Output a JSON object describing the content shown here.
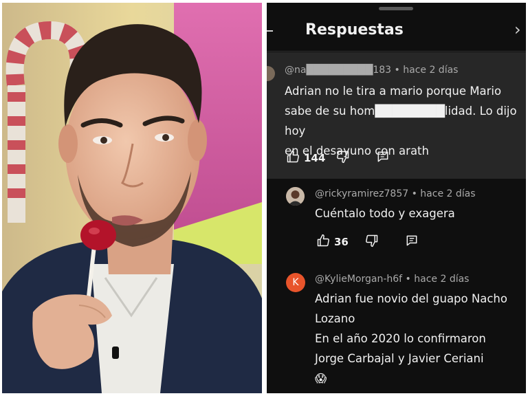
{
  "sheet": {
    "title": "Respuestas"
  },
  "comments": [
    {
      "author": "@na█████████183",
      "time": "• hace 2 días",
      "lines": [
        "Adrian no le tira a mario porque Mario",
        "sabe de su hom████████lidad. Lo dijo hoy",
        "en el desayuno con arath"
      ],
      "likes": "144"
    },
    {
      "author": "@rickyramirez7857",
      "time": "• hace 2 días",
      "lines": [
        "Cuéntalo todo y exagera"
      ],
      "likes": "36"
    },
    {
      "author": "@KylieMorgan-h6f",
      "time": "• hace 2 días",
      "avatar_letter": "K",
      "avatar_color": "#e8542b",
      "lines": [
        "Adrian fue novio del guapo Nacho",
        "Lozano",
        "En el año 2020 lo confirmaron",
        "Jorge Carbajal y Javier Ceriani",
        "😱"
      ]
    }
  ],
  "icons": {
    "like": "thumbs-up-icon",
    "dislike": "thumbs-down-icon",
    "reply": "reply-icon"
  },
  "colors": {
    "sheet_bg": "#0f0f0f",
    "highlight_bg": "#272727",
    "meta_text": "#aaaaaa"
  }
}
